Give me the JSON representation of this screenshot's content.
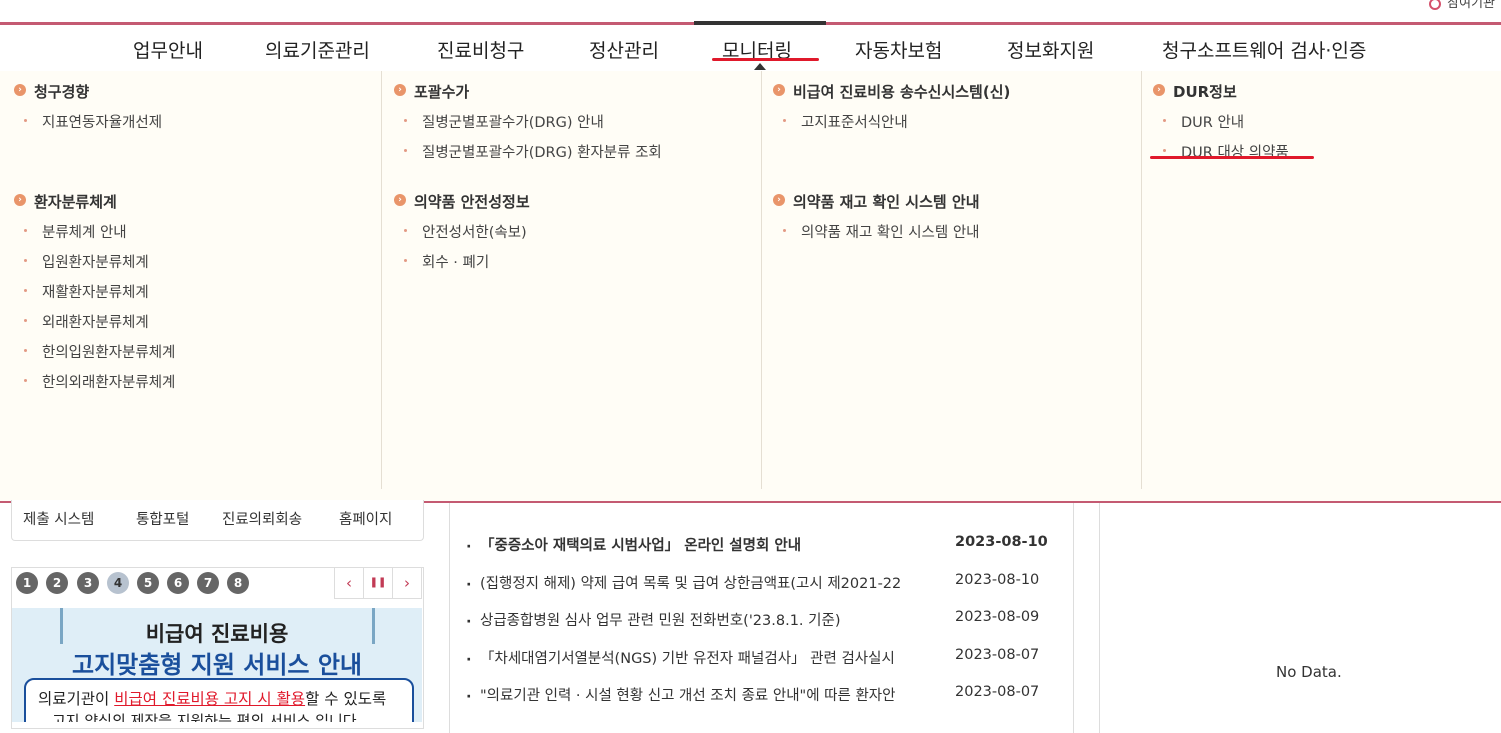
{
  "header": {
    "util_label": "참여기관"
  },
  "gnb": {
    "items": [
      {
        "label": "업무안내"
      },
      {
        "label": "의료기준관리"
      },
      {
        "label": "진료비청구"
      },
      {
        "label": "정산관리"
      },
      {
        "label": "모니터링"
      },
      {
        "label": "자동차보험"
      },
      {
        "label": "정보화지원"
      },
      {
        "label": "청구소프트웨어 검사·인증"
      }
    ],
    "active": "모니터링"
  },
  "mega_menu": {
    "columns": [
      {
        "groups": [
          {
            "title": "청구경향",
            "items": [
              "지표연동자율개선제"
            ]
          },
          {
            "title": "환자분류체계",
            "items": [
              "분류체계 안내",
              "입원환자분류체계",
              "재활환자분류체계",
              "외래환자분류체계",
              "한의입원환자분류체계",
              "한의외래환자분류체계"
            ]
          }
        ]
      },
      {
        "groups": [
          {
            "title": "포괄수가",
            "items": [
              "질병군별포괄수가(DRG) 안내",
              "질병군별포괄수가(DRG) 환자분류 조회"
            ]
          },
          {
            "title": "의약품 안전성정보",
            "items": [
              "안전성서한(속보)",
              "회수 · 폐기"
            ]
          }
        ]
      },
      {
        "groups": [
          {
            "title": "비급여 진료비용 송수신시스템(신)",
            "items": [
              "고지표준서식안내"
            ]
          },
          {
            "title": "의약품 재고 확인 시스템 안내",
            "items": [
              "의약품 재고 확인 시스템 안내"
            ]
          }
        ]
      },
      {
        "groups": [
          {
            "title": "DUR정보",
            "items": [
              "DUR 안내",
              "DUR 대상 의약품"
            ]
          }
        ]
      }
    ]
  },
  "quick_links": [
    "제출 시스템",
    "통합포털",
    "진료의뢰회송",
    "홈페이지"
  ],
  "banner": {
    "pages": [
      "1",
      "2",
      "3",
      "4",
      "5",
      "6",
      "7",
      "8"
    ],
    "current_page": "4",
    "prev_label": "‹",
    "pause_label": "❚❚",
    "next_label": "›",
    "line1": "비급여 진료비용",
    "line2": "고지맞춤형 지원 서비스 안내",
    "line3_pre": "의료기관이 ",
    "line3_em": "비급여 진료비용 고지 시 활용",
    "line3_post": "할 수 있도록",
    "line4": "고지 양식의 제작을 지원하는 편의 서비스 입니다"
  },
  "news": [
    {
      "title": "「중증소아 재택의료 시범사업」 온라인 설명회 안내",
      "date": "2023-08-10"
    },
    {
      "title": "(집행정지 해제) 약제 급여 목록 및 급여 상한금액표(고시 제2021-22",
      "date": "2023-08-10"
    },
    {
      "title": "상급종합병원 심사 업무 관련 민원 전화번호('23.8.1. 기준)",
      "date": "2023-08-09"
    },
    {
      "title": "「차세대염기서열분석(NGS) 기반 유전자 패널검사」 관련 검사실시",
      "date": "2023-08-07"
    },
    {
      "title": "\"의료기관 인력 · 시설 현황 신고 개선 조치 종료 안내\"에 따른 환자안",
      "date": "2023-08-07"
    }
  ],
  "right_panel": {
    "empty_text": "No Data."
  },
  "colors": {
    "accent": "#c45a72",
    "highlight_red": "#e0192b",
    "menu_bg": "#fffdf6",
    "bullet_orange": "#e9956a"
  }
}
